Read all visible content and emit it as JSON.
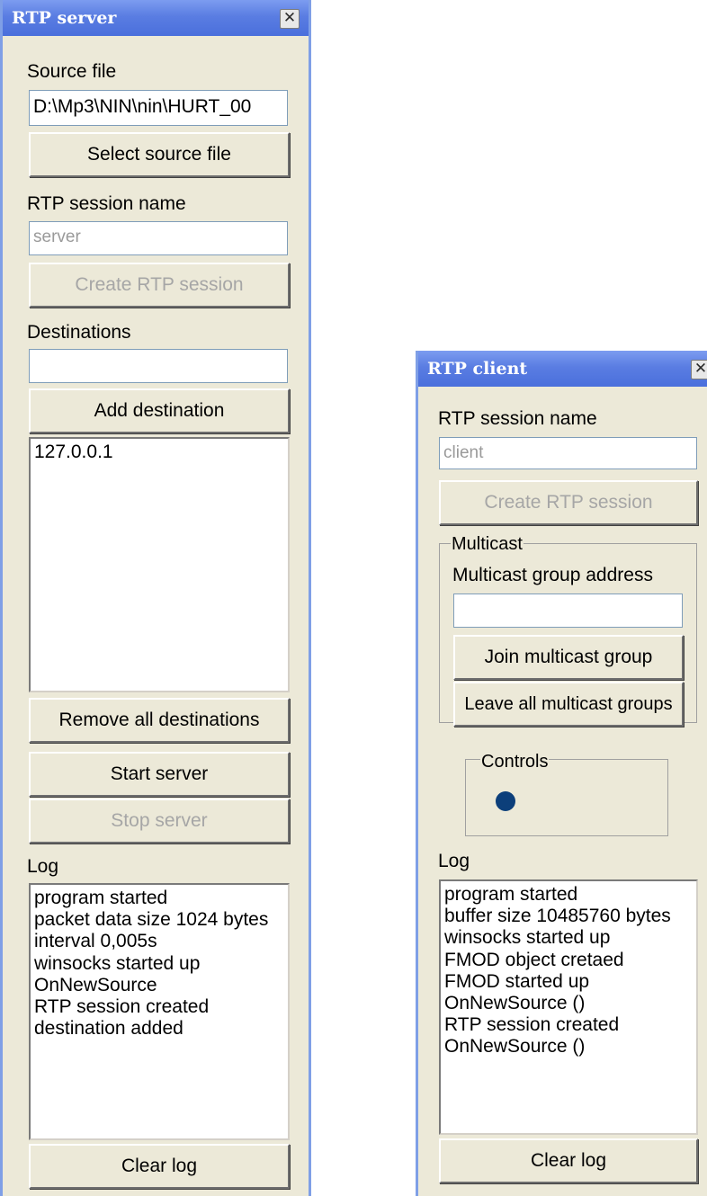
{
  "server": {
    "title": "RTP server",
    "close_glyph": "✕",
    "source_file_label": "Source file",
    "source_file_value": "D:\\Mp3\\NIN\\nin\\HURT_00",
    "select_source_button": "Select source file",
    "session_name_label": "RTP session name",
    "session_name_value": "server",
    "create_session_button": "Create RTP session",
    "destinations_label": "Destinations",
    "destination_input_value": "",
    "add_destination_button": "Add destination",
    "destinations": [
      "127.0.0.1"
    ],
    "remove_all_button": "Remove all destinations",
    "start_button": "Start server",
    "stop_button": "Stop server",
    "log_label": "Log",
    "log": [
      "program started",
      "packet data size 1024 bytes",
      "interval 0,005s",
      "winsocks started up",
      "OnNewSource",
      "RTP session created",
      "destination added"
    ],
    "clear_log_button": "Clear log"
  },
  "client": {
    "title": "RTP client",
    "close_glyph": "✕",
    "session_name_label": "RTP session name",
    "session_name_value": "client",
    "create_session_button": "Create RTP session",
    "multicast_group_title": "Multicast",
    "multicast_address_label": "Multicast group address",
    "multicast_address_value": "",
    "join_button": "Join multicast group",
    "leave_button": "Leave all multicast groups",
    "controls_group_title": "Controls",
    "status_dot_color": "#0c3f7a",
    "log_label": "Log",
    "log": [
      "program started",
      "buffer size 10485760 bytes",
      "winsocks started up",
      "FMOD object cretaed",
      "FMOD started up",
      "OnNewSource ()",
      "RTP session created",
      "OnNewSource ()"
    ],
    "clear_log_button": "Clear log"
  },
  "icons": {
    "close": "close-icon",
    "status": "status-dot-icon"
  }
}
